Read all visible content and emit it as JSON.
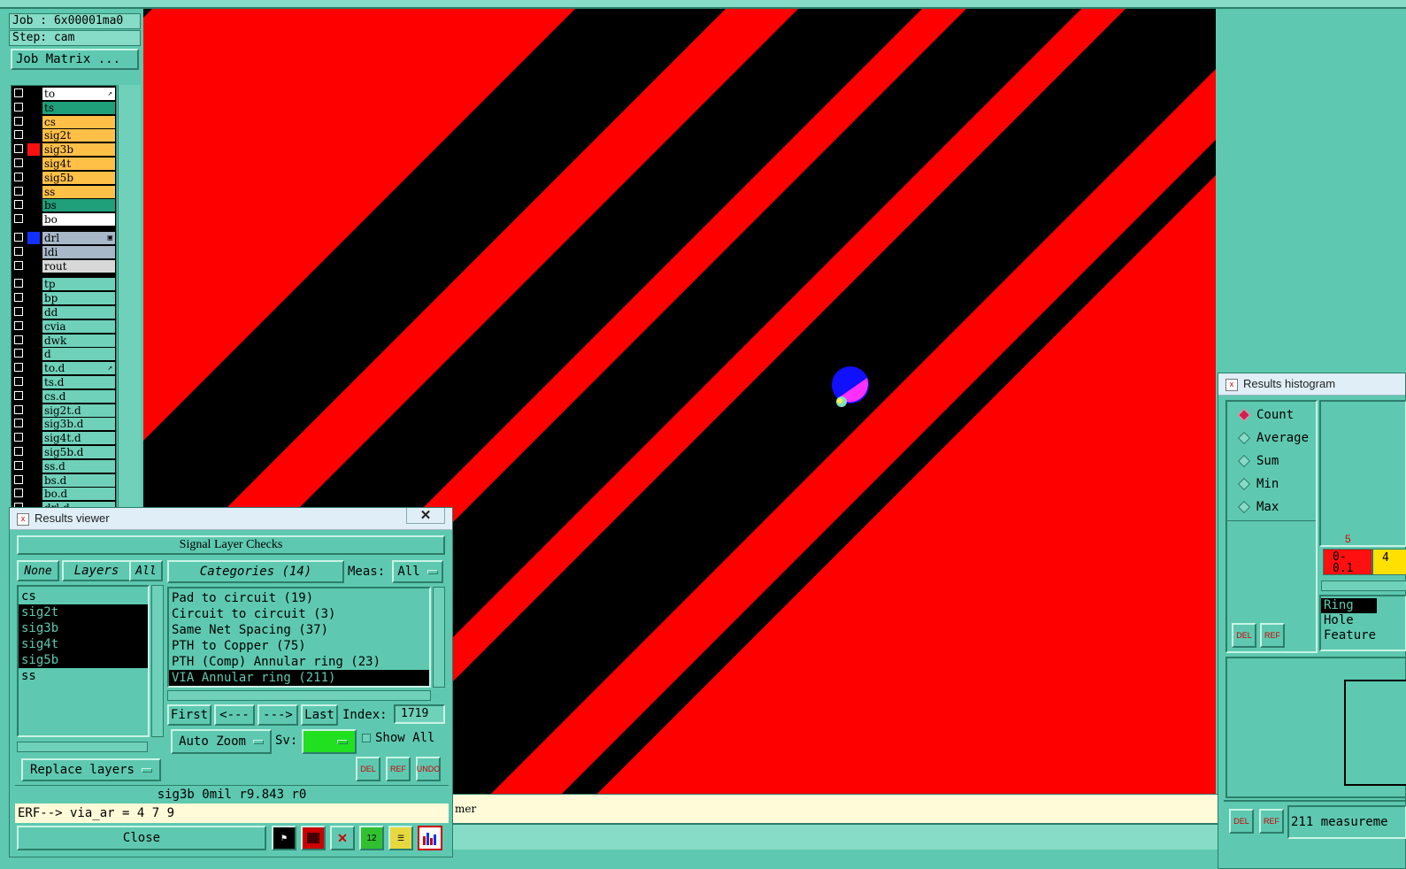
{
  "job": {
    "label": "Job : 6x00001ma0",
    "step": "Step: cam",
    "matrix_button": "Job Matrix ..."
  },
  "layers_group1": [
    {
      "name": "to",
      "bg": "#ffffff",
      "swatch": "#000000",
      "tag": "↗"
    },
    {
      "name": "ts",
      "bg": "#1f9f7a",
      "swatch": "#000000",
      "tag": ""
    },
    {
      "name": "cs",
      "bg": "#ffc048",
      "swatch": "#000000",
      "tag": ""
    },
    {
      "name": "sig2t",
      "bg": "#ffc048",
      "swatch": "#000000",
      "tag": ""
    },
    {
      "name": "sig3b",
      "bg": "#ffc048",
      "swatch": "#ff1010",
      "tag": ""
    },
    {
      "name": "sig4t",
      "bg": "#ffc048",
      "swatch": "#000000",
      "tag": ""
    },
    {
      "name": "sig5b",
      "bg": "#ffc048",
      "swatch": "#000000",
      "tag": ""
    },
    {
      "name": "ss",
      "bg": "#ffc048",
      "swatch": "#000000",
      "tag": ""
    },
    {
      "name": "bs",
      "bg": "#1f9f7a",
      "swatch": "#000000",
      "tag": ""
    },
    {
      "name": "bo",
      "bg": "#ffffff",
      "swatch": "#000000",
      "tag": ""
    }
  ],
  "layers_group2": [
    {
      "name": "drl",
      "bg": "#a8b8c8",
      "swatch": "#1030ff",
      "tag": "▣"
    },
    {
      "name": "ldi",
      "bg": "#a8b8c8",
      "swatch": "#000000",
      "tag": ""
    },
    {
      "name": "rout",
      "bg": "#d8d8d8",
      "swatch": "#000000",
      "tag": ""
    }
  ],
  "layers_group3": [
    {
      "name": "tp",
      "tag": ""
    },
    {
      "name": "bp",
      "tag": ""
    },
    {
      "name": "dd",
      "tag": ""
    },
    {
      "name": "cvia",
      "tag": ""
    },
    {
      "name": "dwk",
      "tag": ""
    },
    {
      "name": "d",
      "tag": ""
    },
    {
      "name": "to.d",
      "tag": "↗"
    },
    {
      "name": "ts.d",
      "tag": ""
    },
    {
      "name": "cs.d",
      "tag": ""
    },
    {
      "name": "sig2t.d",
      "tag": ""
    },
    {
      "name": "sig3b.d",
      "tag": ""
    },
    {
      "name": "sig4t.d",
      "tag": ""
    },
    {
      "name": "sig5b.d",
      "tag": ""
    },
    {
      "name": "ss.d",
      "tag": ""
    },
    {
      "name": "bs.d",
      "tag": ""
    },
    {
      "name": "bo.d",
      "tag": ""
    },
    {
      "name": "drl.d",
      "tag": ""
    }
  ],
  "colors": {
    "canvas_red": "#ff0000",
    "canvas_black": "#000000",
    "via_blue": "#1010ff",
    "via_magenta": "#ff30ff",
    "panel": "#5ec9b0",
    "status_bg": "#fffbd8"
  },
  "canvas_status": "mer",
  "results_viewer": {
    "title": "Results viewer",
    "close_x": "✕",
    "header": "Signal Layer Checks",
    "none_btn": "None",
    "layers_btn": "Layers",
    "all_btn": "All",
    "layers": [
      {
        "name": "cs",
        "selected": false
      },
      {
        "name": "sig2t",
        "selected": true
      },
      {
        "name": "sig3b",
        "selected": true
      },
      {
        "name": "sig4t",
        "selected": true
      },
      {
        "name": "sig5b",
        "selected": true
      },
      {
        "name": "ss",
        "selected": false
      }
    ],
    "replace_btn": "Replace layers",
    "categories_btn": "Categories (14)",
    "meas_label": "Meas:",
    "meas_value": "All",
    "categories": [
      {
        "name": "Pad to circuit (19)",
        "selected": false
      },
      {
        "name": "Circuit to circuit (3)",
        "selected": false
      },
      {
        "name": "Same Net Spacing (37)",
        "selected": false
      },
      {
        "name": "PTH to Copper (75)",
        "selected": false
      },
      {
        "name": "PTH (Comp) Annular ring (23)",
        "selected": false
      },
      {
        "name": "VIA Annular ring (211)",
        "selected": true
      }
    ],
    "first_btn": "First",
    "prev_btn": "<---",
    "next_btn": "--->",
    "last_btn": "Last",
    "index_label": "Index:",
    "index_value": "1719",
    "zoom_btn": "Auto Zoom",
    "sv_label": "Sv:",
    "show_all": "Show All",
    "del_label": "DEL",
    "ref_label": "REF",
    "undo_label": "UNDO",
    "status_line": "sig3b  0mil   r9.843   r0",
    "erf_line": "ERF--> via_ar = 4 7 9",
    "close_btn": "Close"
  },
  "histogram": {
    "title": "Results histogram",
    "modes": [
      {
        "label": "Count",
        "on": true
      },
      {
        "label": "Average",
        "on": false
      },
      {
        "label": "Sum",
        "on": false
      },
      {
        "label": "Min",
        "on": false
      },
      {
        "label": "Max",
        "on": false
      }
    ],
    "bar_count": "5",
    "bar_range": "0-\n0.1",
    "bar_next": "4",
    "features": [
      {
        "label": "Ring",
        "selected": true
      },
      {
        "label": "Hole",
        "selected": false
      },
      {
        "label": "Feature",
        "selected": false
      }
    ],
    "del_label": "DEL",
    "ref_label": "REF",
    "measurements": "211 measureme"
  }
}
